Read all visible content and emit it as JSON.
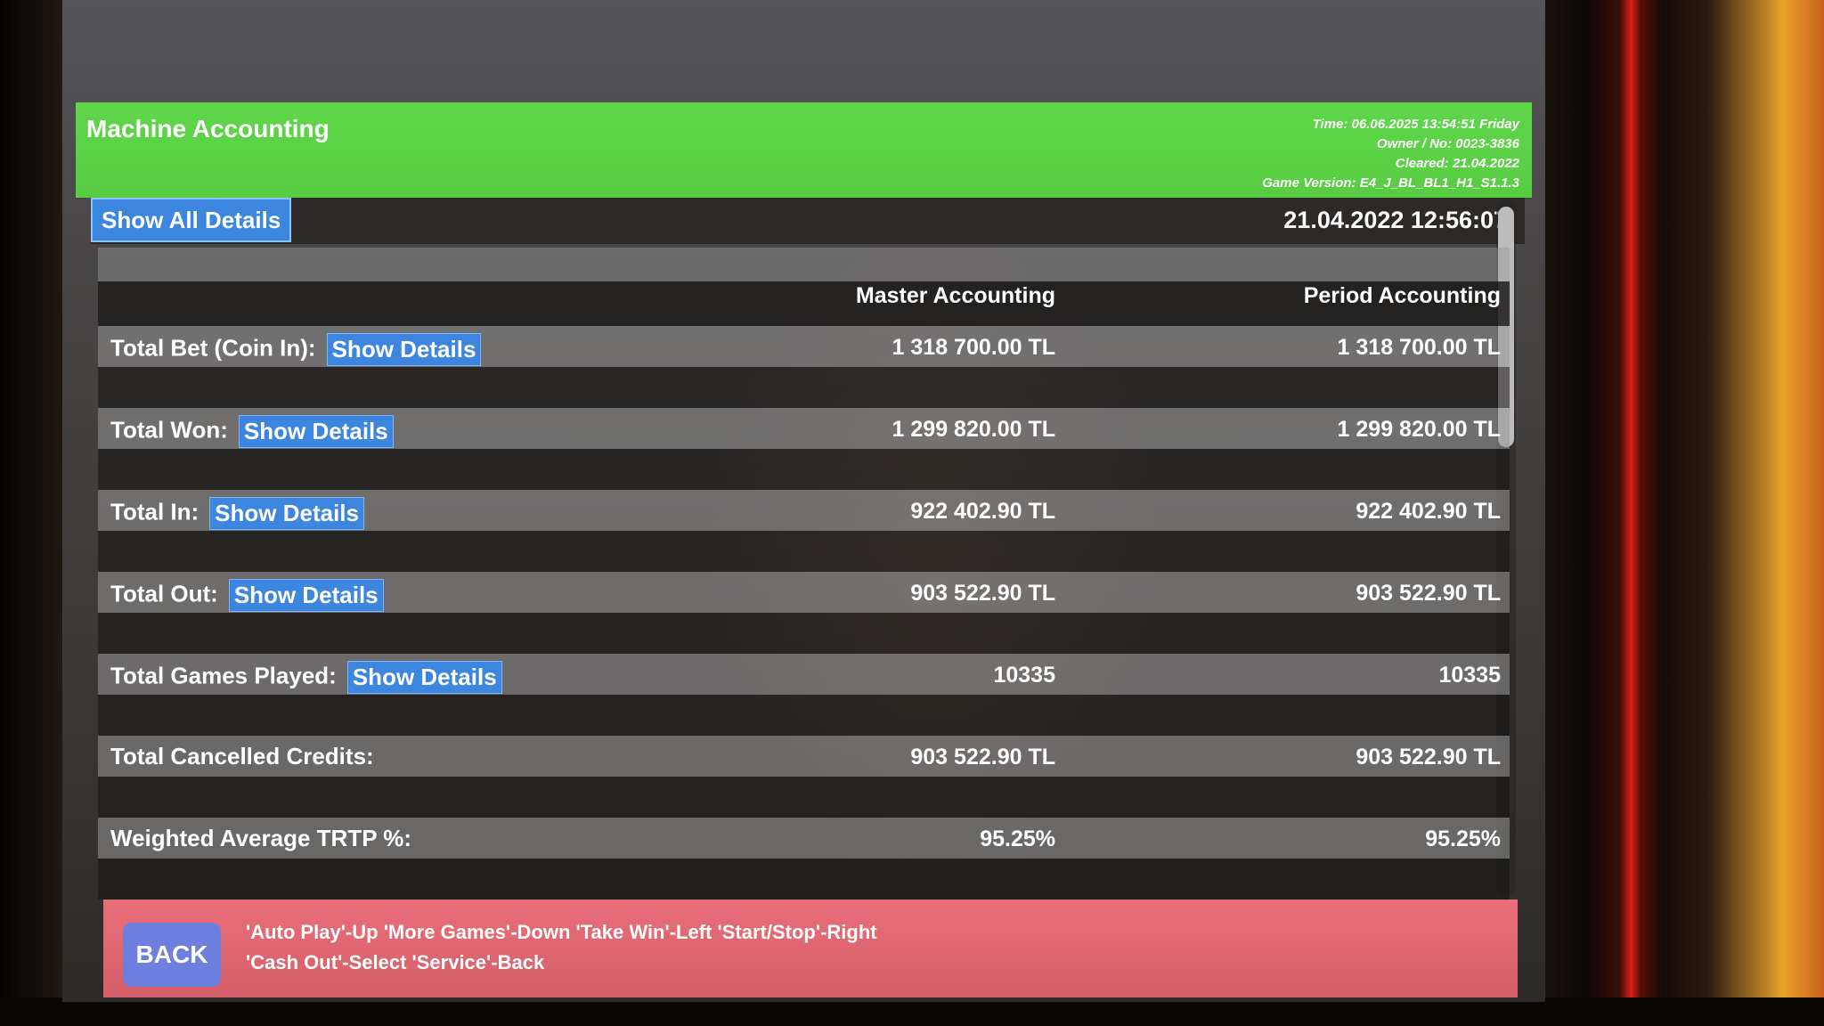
{
  "header": {
    "title": "Machine Accounting",
    "time": "Time: 06.06.2025  13:54:51  Friday",
    "owner": "Owner / No: 0023-3836",
    "cleared": "Cleared: 21.04.2022",
    "game_version": "Game Version: E4_J_BL_BL1_H1_S1.1.3"
  },
  "toolbar": {
    "show_all_label": "Show All Details",
    "datetime": "21.04.2022  12:56:07"
  },
  "columns": {
    "master": "Master Accounting",
    "period": "Period Accounting"
  },
  "rows": [
    {
      "label": "Total Bet (Coin In):",
      "button": "Show Details",
      "master": "1 318 700.00 TL",
      "period": "1 318 700.00 TL"
    },
    {
      "label": "Total Won:",
      "button": "Show Details",
      "master": "1 299 820.00 TL",
      "period": "1 299 820.00 TL"
    },
    {
      "label": "Total In:",
      "button": "Show Details",
      "master": "922 402.90 TL",
      "period": "922 402.90 TL"
    },
    {
      "label": "Total Out:",
      "button": "Show Details",
      "master": "903 522.90 TL",
      "period": "903 522.90 TL"
    },
    {
      "label": "Total Games Played:",
      "button": "Show Details",
      "master": "10335",
      "period": "10335"
    },
    {
      "label": "Total Cancelled Credits:",
      "button": "",
      "master": "903 522.90 TL",
      "period": "903 522.90 TL"
    },
    {
      "label": "Weighted Average TRTP %:",
      "button": "",
      "master": "95.25%",
      "period": "95.25%"
    }
  ],
  "footer": {
    "back_label": "BACK",
    "hint_line1": "'Auto Play'-Up  'More Games'-Down  'Take Win'-Left  'Start/Stop'-Right",
    "hint_line2": "'Cash Out'-Select  'Service'-Back"
  },
  "colors": {
    "title_bar": "#5fd74a",
    "button_blue": "#3d86e0",
    "footer_pink": "#e86e7a"
  }
}
